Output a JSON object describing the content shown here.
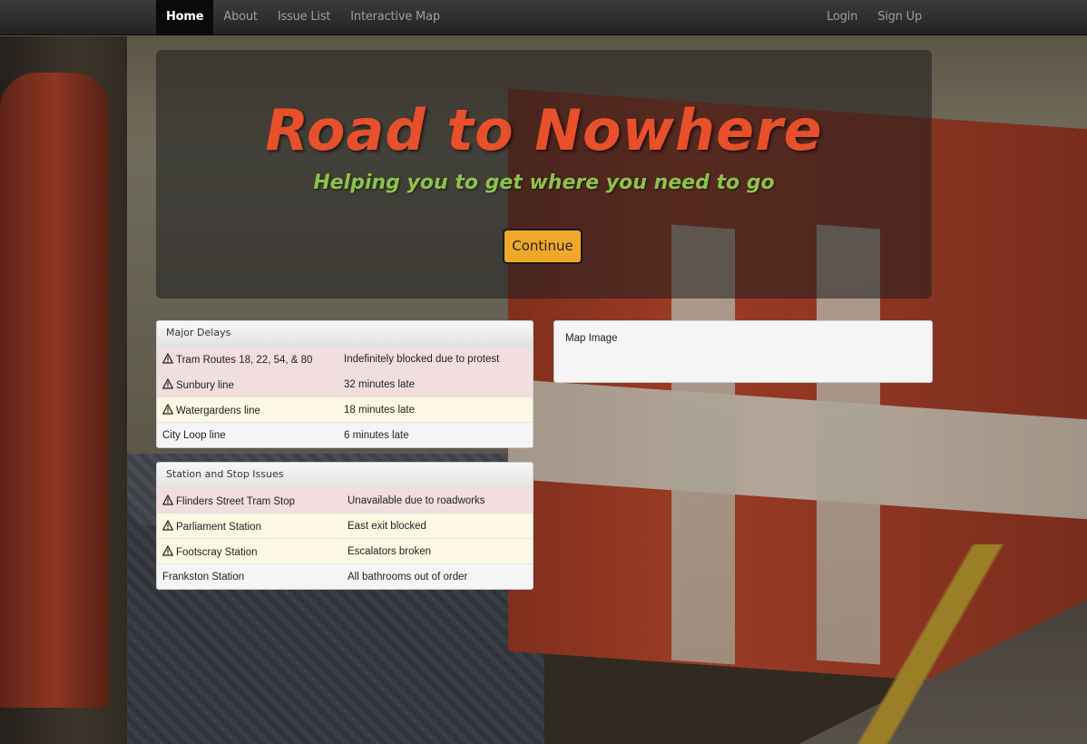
{
  "nav": {
    "left": [
      "Home",
      "About",
      "Issue List",
      "Interactive Map"
    ],
    "right": [
      "Login",
      "Sign Up"
    ]
  },
  "hero": {
    "title": "Road to Nowhere",
    "subtitle": "Helping you to get where you need to go",
    "button": "Continue"
  },
  "delays": {
    "heading": "Major Delays",
    "rows": [
      {
        "name": "Tram Routes 18, 22, 54, & 80",
        "status": "Indefinitely blocked due to protest",
        "level": "danger",
        "icon": "warning-icon"
      },
      {
        "name": "Sunbury line",
        "status": "32 minutes late",
        "level": "danger",
        "icon": "warning-icon"
      },
      {
        "name": "Watergardens line",
        "status": "18 minutes late",
        "level": "warning",
        "icon": "warning-icon"
      },
      {
        "name": "City Loop line",
        "status": "6 minutes late",
        "level": "default"
      }
    ]
  },
  "stations": {
    "heading": "Station and Stop Issues",
    "rows": [
      {
        "name": "Flinders Street Tram Stop",
        "status": "Unavailable due to roadworks",
        "level": "danger",
        "icon": "warning-icon"
      },
      {
        "name": "Parliament Station",
        "status": "East exit blocked",
        "level": "warning",
        "icon": "warning-icon"
      },
      {
        "name": "Footscray Station",
        "status": "Escalators broken",
        "level": "warning",
        "icon": "warning-icon"
      },
      {
        "name": "Frankston Station",
        "status": "All bathrooms out of order",
        "level": "default"
      }
    ]
  },
  "map": {
    "label": "Map Image"
  },
  "colors": {
    "title": "#e8502c",
    "subtitle": "#8cc34a",
    "button": "#f0a82a",
    "danger_row": "#f2dede",
    "warning_row": "#fcf8e3"
  }
}
